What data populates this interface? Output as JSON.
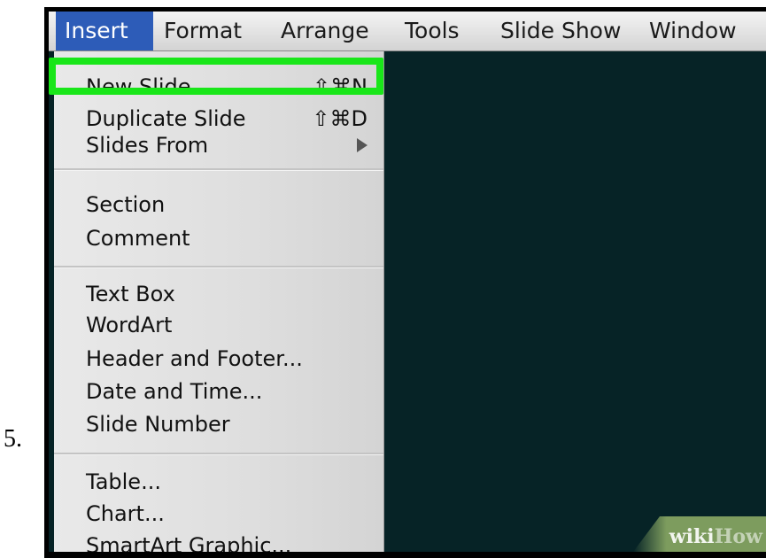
{
  "step_number": "5.",
  "menubar": {
    "items": [
      {
        "label": "Insert",
        "active": true
      },
      {
        "label": "Format",
        "active": false
      },
      {
        "label": "Arrange",
        "active": false
      },
      {
        "label": "Tools",
        "active": false
      },
      {
        "label": "Slide Show",
        "active": false
      },
      {
        "label": "Window",
        "active": false
      }
    ]
  },
  "insert_menu": {
    "groups": [
      [
        {
          "label": "New Slide",
          "shortcut": "⇧⌘N"
        },
        {
          "label": "Duplicate Slide",
          "shortcut": "⇧⌘D",
          "highlighted": true
        },
        {
          "label": "Slides From",
          "submenu": true
        }
      ],
      [
        {
          "label": "Section"
        },
        {
          "label": "Comment"
        }
      ],
      [
        {
          "label": "Text Box"
        },
        {
          "label": "WordArt"
        },
        {
          "label": "Header and Footer..."
        },
        {
          "label": "Date and Time..."
        },
        {
          "label": "Slide Number"
        }
      ],
      [
        {
          "label": "Table..."
        },
        {
          "label": "Chart..."
        },
        {
          "label": "SmartArt Graphic..."
        }
      ]
    ]
  },
  "watermark": {
    "part1": "wiki",
    "part2": "How"
  },
  "colors": {
    "highlight": "#19e619",
    "menu_active": "#2d5cb8",
    "slide_area": "#062326"
  }
}
